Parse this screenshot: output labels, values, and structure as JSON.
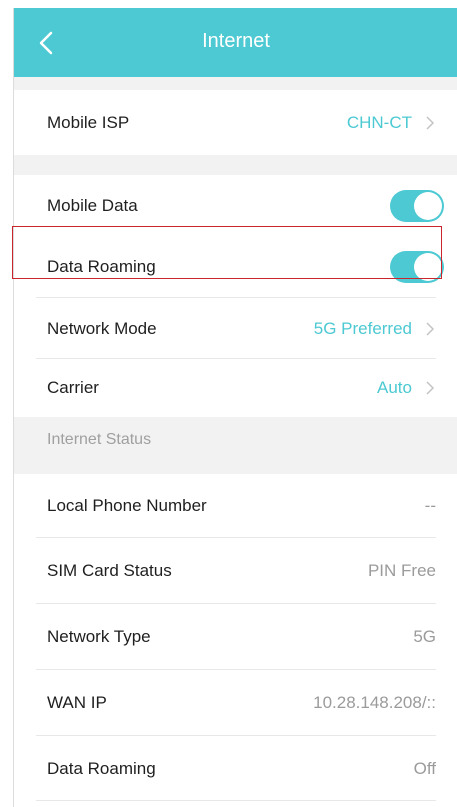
{
  "header": {
    "title": "Internet"
  },
  "isp": {
    "label": "Mobile ISP",
    "value": "CHN-CT"
  },
  "settings": {
    "mobile_data": {
      "label": "Mobile Data",
      "on": true
    },
    "data_roaming": {
      "label": "Data Roaming",
      "on": true
    },
    "network_mode": {
      "label": "Network Mode",
      "value": "5G Preferred"
    },
    "carrier": {
      "label": "Carrier",
      "value": "Auto"
    }
  },
  "status": {
    "heading": "Internet Status",
    "rows": [
      {
        "label": "Local Phone Number",
        "value": "--"
      },
      {
        "label": "SIM Card Status",
        "value": "PIN Free"
      },
      {
        "label": "Network Type",
        "value": "5G"
      },
      {
        "label": "WAN IP",
        "value": "10.28.148.208/::"
      },
      {
        "label": "Data Roaming",
        "value": "Off"
      }
    ]
  },
  "colors": {
    "accent": "#4cc9d2",
    "highlight": "#c8262c",
    "section_bg": "#f2f2f2"
  }
}
